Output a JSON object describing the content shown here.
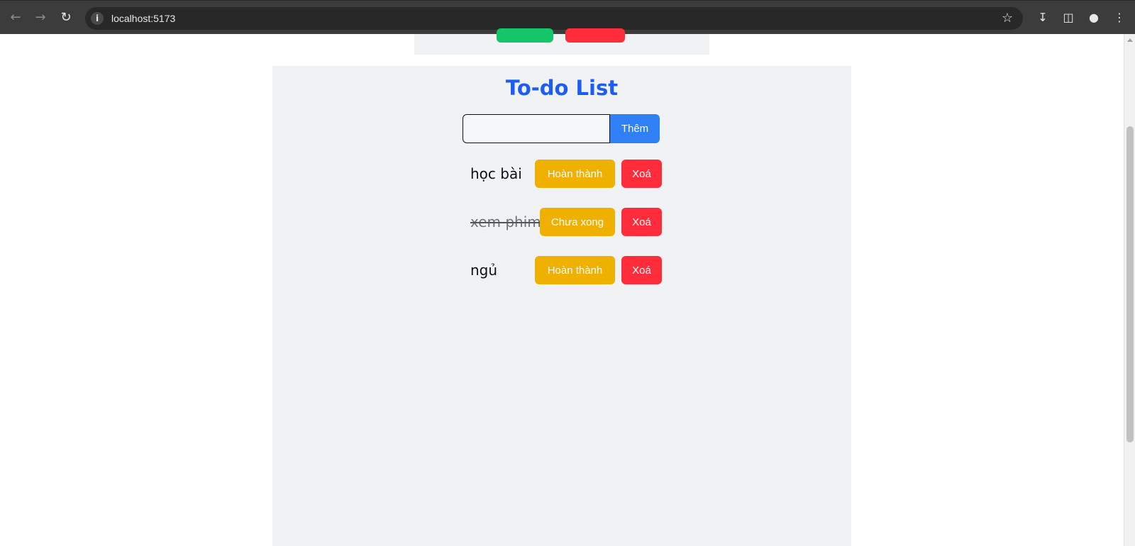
{
  "browser": {
    "url": "localhost:5173",
    "icons": [
      "back-icon",
      "forward-icon",
      "reload-icon",
      "info-icon",
      "star-icon",
      "download-icon",
      "side-panel-icon",
      "profile-icon",
      "menu-icon"
    ]
  },
  "app": {
    "title": "To-do List",
    "input_value": "",
    "add_label": "Thêm",
    "todos": [
      {
        "text": "học bài",
        "done": false,
        "status_label": "Hoàn thành",
        "delete_label": "Xoá"
      },
      {
        "text": "xem phim",
        "done": true,
        "status_label": "Chưa xong",
        "delete_label": "Xoá"
      },
      {
        "text": "ngủ",
        "done": false,
        "status_label": "Hoàn thành",
        "delete_label": "Xoá"
      }
    ]
  },
  "colors": {
    "title": "#1d5ef0",
    "add_button": "#2f7ff5",
    "status_button": "#f0b000",
    "delete_button": "#ff2d3b",
    "panel": "#f1f2f4"
  }
}
